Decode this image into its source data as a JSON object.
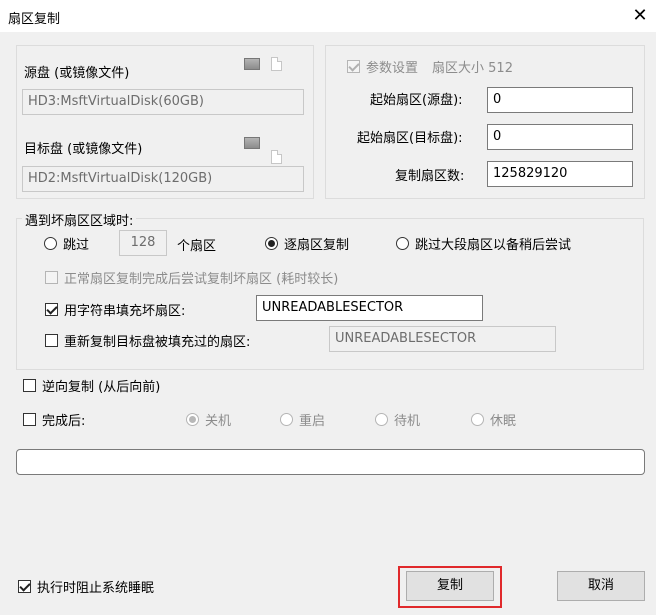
{
  "window": {
    "title": "扇区复制",
    "close_glyph": "✕"
  },
  "source": {
    "label": "源盘 (或镜像文件)",
    "value": "HD3:MsftVirtualDisk(60GB)"
  },
  "target": {
    "label": "目标盘 (或镜像文件)",
    "value": "HD2:MsftVirtualDisk(120GB)"
  },
  "params": {
    "checkbox_label": "参数设置",
    "sector_size_label": "扇区大小 512",
    "start_source_label": "起始扇区(源盘):",
    "start_source_value": "0",
    "start_target_label": "起始扇区(目标盘):",
    "start_target_value": "0",
    "count_label": "复制扇区数:",
    "count_value": "125829120"
  },
  "bad_sector": {
    "group_label": "遇到坏扇区区域时:",
    "skip_label": "跳过",
    "skip_count": "128",
    "skip_unit": "个扇区",
    "sector_by_sector_label": "逐扇区复制",
    "skip_large_label": "跳过大段扇区以备稍后尝试",
    "retry_label": "正常扇区复制完成后尝试复制坏扇区 (耗时较长)",
    "fill_label": "用字符串填充坏扇区:",
    "fill_value": "UNREADABLESECTOR",
    "recopy_label": "重新复制目标盘被填充过的扇区:",
    "recopy_value": "UNREADABLESECTOR"
  },
  "reverse": {
    "label": "逆向复制 (从后向前)"
  },
  "after": {
    "label": "完成后:",
    "options": [
      "关机",
      "重启",
      "待机",
      "休眠"
    ]
  },
  "footer": {
    "prevent_sleep_label": "执行时阻止系统睡眠",
    "copy_button": "复制",
    "cancel_button": "取消"
  },
  "colors": {
    "highlight": "#e0292b",
    "window_bg": "#f0f0f0"
  }
}
